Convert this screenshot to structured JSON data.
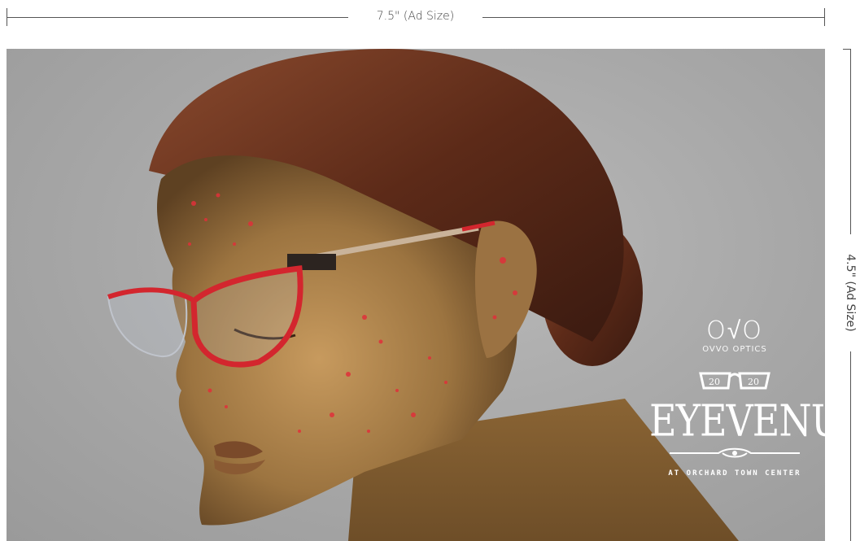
{
  "dimensions": {
    "width_label": "7.5\" (Ad Size)",
    "height_label": "4.5\" (Ad Size)"
  },
  "brand": {
    "ovvo_logo": "O√O",
    "ovvo_name": "OVVO OPTICS",
    "store_name": "EYEVENUE",
    "tagline": "AT ORCHARD TOWN CENTER"
  },
  "colors": {
    "background": "#a9a9a9",
    "frame_red": "#d3262e",
    "hair": "#5a2a1a",
    "skin_gold": "#a67c45",
    "paint_red": "#e0303a"
  }
}
